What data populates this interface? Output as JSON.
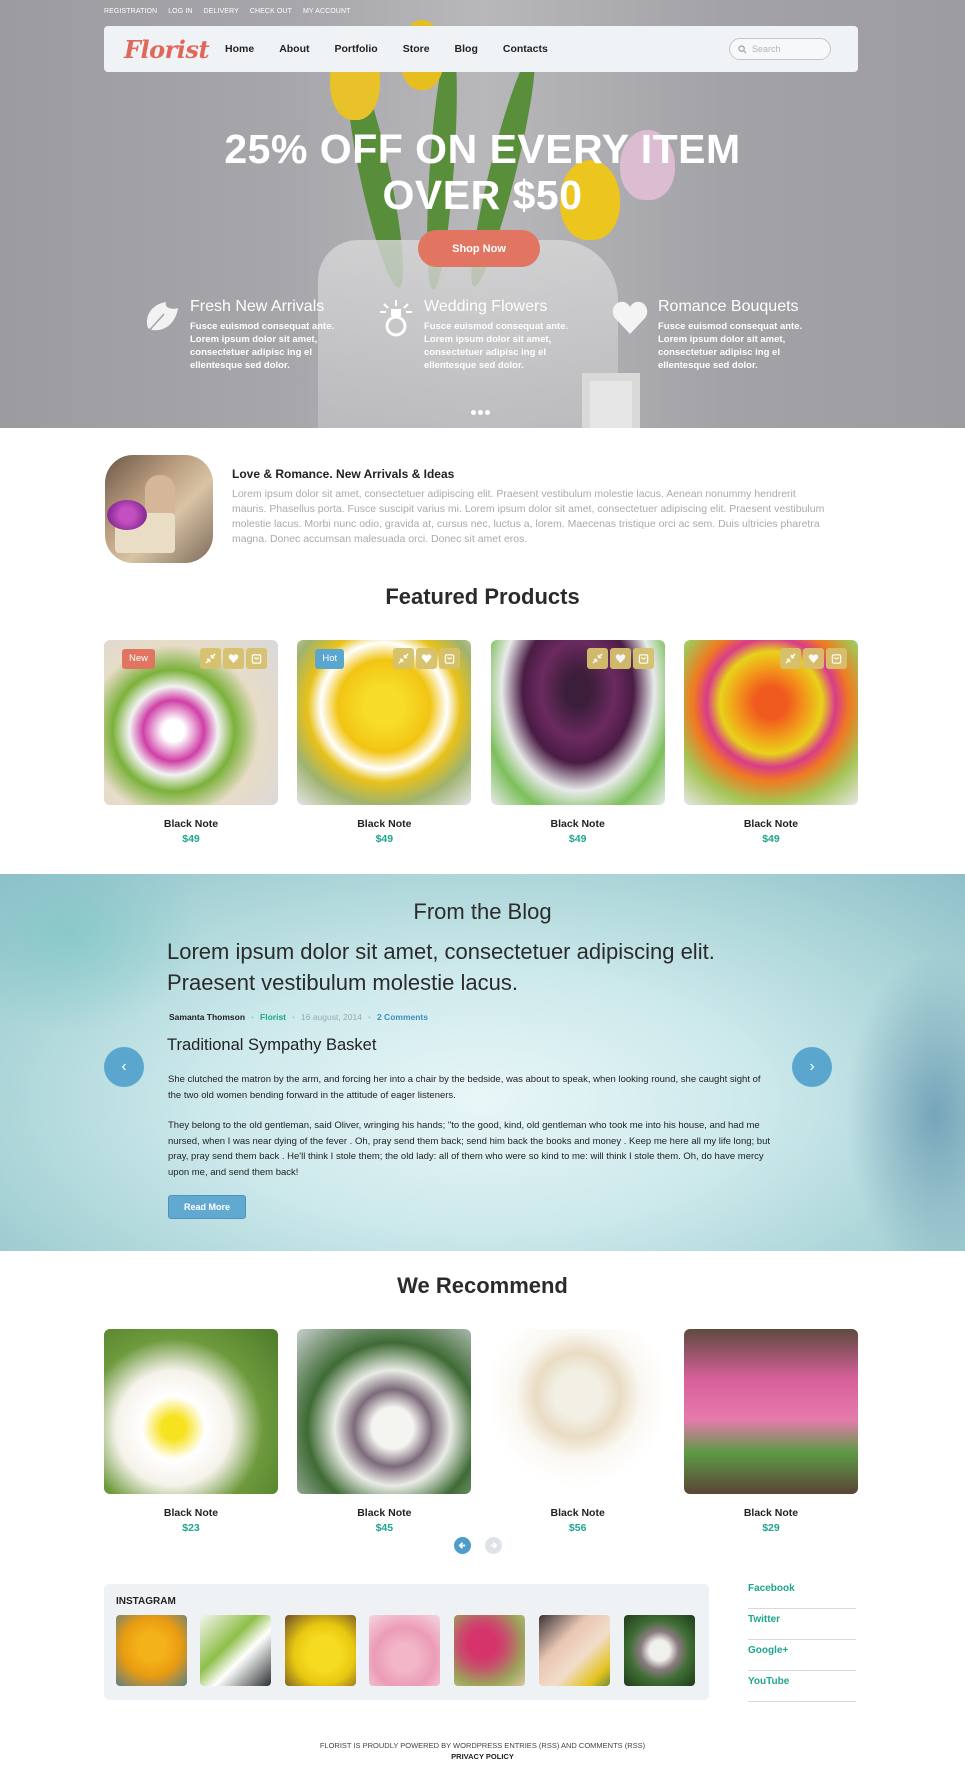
{
  "top_links": [
    "REGISTRATION",
    "LOG IN",
    "DELIVERY",
    "CHECK OUT",
    "MY ACCOUNT"
  ],
  "logo": "Florist",
  "nav": [
    "Home",
    "About",
    "Portfolio",
    "Store",
    "Blog",
    "Contacts"
  ],
  "search": {
    "placeholder": "Search"
  },
  "hero": {
    "title_line1": "25% OFF ON EVERY ITEM",
    "title_line2": "OVER $50",
    "cta": "Shop Now",
    "slides": 3,
    "features": [
      {
        "icon": "leaf-icon",
        "title": "Fresh New Arrivals",
        "text": "Fusce euismod consequat ante. Lorem ipsum dolor sit amet, consectetuer adipisc ing el ellentesque sed dolor."
      },
      {
        "icon": "ring-icon",
        "title": "Wedding Flowers",
        "text": "Fusce euismod consequat ante. Lorem ipsum dolor sit amet, consectetuer adipisc ing el ellentesque sed dolor."
      },
      {
        "icon": "heart-icon",
        "title": "Romance Bouquets",
        "text": "Fusce euismod consequat ante. Lorem ipsum dolor sit amet, consectetuer adipisc ing el ellentesque sed dolor."
      }
    ]
  },
  "intro": {
    "title": "Love & Romance. New Arrivals & Ideas",
    "text": "Lorem ipsum dolor sit amet, consectetuer adipiscing elit. Praesent vestibulum molestie lacus. Aenean nonummy hendrerit mauris. Phasellus porta. Fusce suscipit varius mi. Lorem ipsum dolor sit amet, consectetuer adipiscing elit. Praesent vestibulum molestie lacus. Morbi nunc odio, gravida at, cursus nec, luctus a, lorem. Maecenas tristique orci ac sem. Duis ultricies pharetra magna. Donec accumsan malesuada orci. Donec sit amet eros."
  },
  "featured": {
    "title": "Featured Products",
    "products": [
      {
        "name": "Black Note",
        "price": "$49",
        "badge": "New",
        "badge_color": "#e17562"
      },
      {
        "name": "Black Note",
        "price": "$49",
        "badge": "Hot",
        "badge_color": "#5aa6cf"
      },
      {
        "name": "Black Note",
        "price": "$49",
        "badge": "",
        "badge_color": ""
      },
      {
        "name": "Black Note",
        "price": "$49",
        "badge": "",
        "badge_color": ""
      }
    ]
  },
  "blog": {
    "title": "From the Blog",
    "lead": "Lorem ipsum dolor sit amet, consectetuer adipiscing elit. Praesent vestibulum molestie lacus.",
    "author": "Samanta Thomson",
    "category": "Florist",
    "date": "16 august, 2014",
    "comments": "2 Comments",
    "post_title": "Traditional Sympathy Basket",
    "para1": "She clutched the matron by the arm, and forcing her into a chair by the bedside, was about to speak, when looking round, she caught sight of the two old women bending forward in the attitude of eager listeners.",
    "para2": "They belong to the old gentleman, said Oliver, wringing his hands; \"to the good, kind, old gentleman who took me into his house, and had me nursed, when I was near dying of the fever . Oh, pray send them back; send him back the books and money . Keep me here all my life long; but pray, pray send them back . He'll think I stole them; the old lady: all of them who were so kind to me: will think I stole them. Oh, do have mercy upon me, and send them back!",
    "read_more": "Read More",
    "prev": "‹",
    "next": "›"
  },
  "recommend": {
    "title": "We Recommend",
    "products": [
      {
        "name": "Black Note",
        "price": "$23"
      },
      {
        "name": "Black Note",
        "price": "$45"
      },
      {
        "name": "Black Note",
        "price": "$56"
      },
      {
        "name": "Black Note",
        "price": "$29"
      }
    ]
  },
  "instagram": {
    "title": "INSTAGRAM",
    "count": 7
  },
  "social": [
    "Facebook",
    "Twitter",
    "Google+",
    "YouTube"
  ],
  "footer": {
    "line1": "FLORIST IS PROUDLY POWERED BY WORDPRESS ENTRIES (RSS) AND COMMENTS (RSS)",
    "line2": "PRIVACY POLICY"
  },
  "colors": {
    "accent": "#e17562",
    "teal": "#1ea58d",
    "blue": "#5aa6cf",
    "gold": "#d6c16d"
  }
}
